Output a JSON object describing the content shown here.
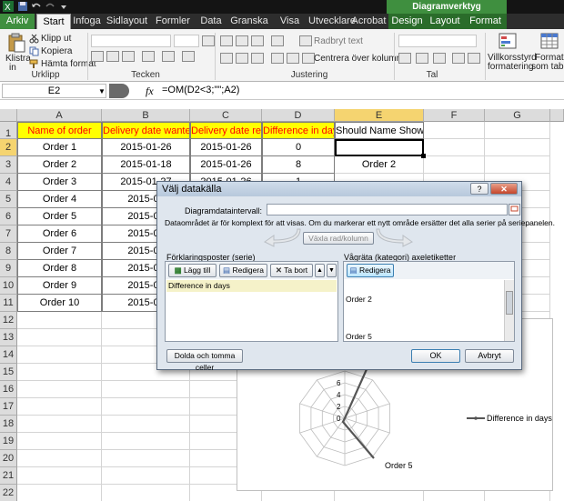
{
  "quick_access": [
    "excel-icon",
    "save-icon",
    "undo-icon",
    "redo-icon",
    "dropdown-icon"
  ],
  "context_tab_group": "Diagramverktyg",
  "tabs": [
    {
      "label": "Arkiv",
      "kind": "file"
    },
    {
      "label": "Start",
      "kind": "active"
    },
    {
      "label": "Infoga",
      "kind": ""
    },
    {
      "label": "Sidlayout",
      "kind": ""
    },
    {
      "label": "Formler",
      "kind": ""
    },
    {
      "label": "Data",
      "kind": ""
    },
    {
      "label": "Granska",
      "kind": ""
    },
    {
      "label": "Visa",
      "kind": ""
    },
    {
      "label": "Utvecklare",
      "kind": ""
    },
    {
      "label": "Acrobat",
      "kind": ""
    },
    {
      "label": "Design",
      "kind": "ctx"
    },
    {
      "label": "Layout",
      "kind": "ctx"
    },
    {
      "label": "Format",
      "kind": "ctx"
    }
  ],
  "ribbon": {
    "paste_label": "Klistra",
    "paste_label2": "in",
    "cut": "Klipp ut",
    "copy": "Kopiera",
    "format_painter": "Hämta format",
    "clipboard_group": "Urklipp",
    "font_group": "Tecken",
    "wrap_text": "Radbryt text",
    "merge_center": "Centrera över kolumner",
    "alignment_group": "Justering",
    "number_group": "Tal",
    "cond_format": "Villkorsstyrd",
    "cond_format2": "formatering",
    "format_table": "Formatera",
    "format_table2": "som tabell"
  },
  "formula_bar": {
    "name_box": "E2",
    "fx": "fx",
    "formula": "=OM(D2<3;\"\";A2)"
  },
  "columns": [
    "A",
    "B",
    "C",
    "D",
    "E",
    "F",
    "G"
  ],
  "rows": [
    "1",
    "2",
    "3",
    "4",
    "5",
    "6",
    "7",
    "8",
    "9",
    "10",
    "11",
    "12",
    "13",
    "14",
    "15",
    "16",
    "17",
    "18",
    "19",
    "20",
    "21",
    "22"
  ],
  "headers": [
    "Name of order",
    "Delivery date wanted",
    "Delivery date real",
    "Difference in days",
    "Should Name Show?"
  ],
  "table": [
    [
      "Order 1",
      "2015-01-26",
      "2015-01-26",
      "0",
      ""
    ],
    [
      "Order 2",
      "2015-01-18",
      "2015-01-26",
      "8",
      "Order 2"
    ],
    [
      "Order 3",
      "2015-01-27",
      "2015-01-26",
      "1",
      ""
    ],
    [
      "Order 4",
      "2015-01",
      "",
      "",
      ""
    ],
    [
      "Order 5",
      "2015-01",
      "",
      "",
      ""
    ],
    [
      "Order 6",
      "2015-01",
      "",
      "",
      ""
    ],
    [
      "Order 7",
      "2015-01",
      "",
      "",
      ""
    ],
    [
      "Order 8",
      "2015-01",
      "",
      "",
      ""
    ],
    [
      "Order 9",
      "2015-01",
      "",
      "",
      ""
    ],
    [
      "Order 10",
      "2015-01",
      "",
      "",
      ""
    ]
  ],
  "chart_data": {
    "type": "radar",
    "title": "",
    "tick_labels": [
      "0",
      "2",
      "4",
      "6"
    ],
    "category_labels_visible": [
      "Order 5"
    ],
    "series": [
      {
        "name": "Difference in days"
      }
    ]
  },
  "dialog": {
    "title": "Välj datakälla",
    "help": "?",
    "close": "✕",
    "range_label": "Diagramdataintervall:",
    "range_value": "",
    "info": "Dataområdet är för komplext för att visas. Om du markerar ett nytt område ersätter det alla serier på seriepanelen.",
    "switch": "Växla rad/kolumn",
    "legend_label": "Förklaringsposter (serie)",
    "axis_label": "Vågräta (kategori) axeletiketter",
    "add": "Lägg till",
    "edit": "Redigera",
    "remove": "Ta bort",
    "axis_edit": "Redigera",
    "series_items": [
      "Difference in days"
    ],
    "axis_items": [
      "Order 2",
      "Order 5"
    ],
    "hidden_cells": "Dolda och tomma celler",
    "ok": "OK",
    "cancel": "Avbryt"
  }
}
